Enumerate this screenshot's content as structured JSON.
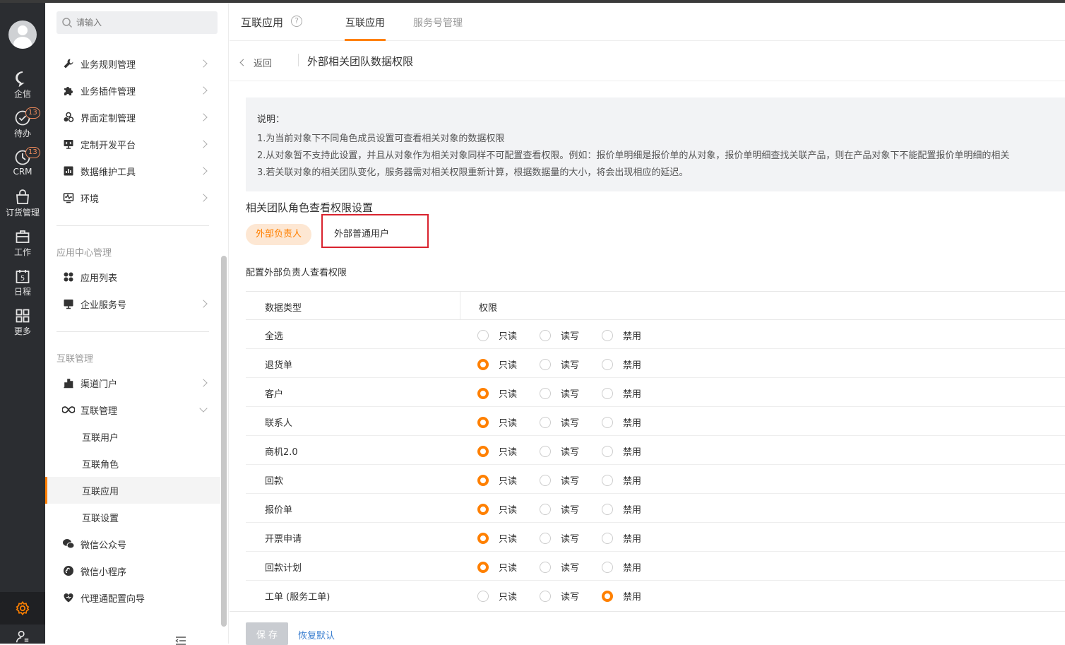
{
  "rail": {
    "items": [
      {
        "label": "企信",
        "icon": "chat-icon"
      },
      {
        "label": "待办",
        "icon": "check-circle-icon",
        "badge": "13"
      },
      {
        "label": "CRM",
        "icon": "clock-icon",
        "badge": "13"
      },
      {
        "label": "订货管理",
        "icon": "bag-icon"
      },
      {
        "label": "工作",
        "icon": "briefcase-icon"
      },
      {
        "label": "日程",
        "icon": "calendar-icon",
        "day": "5"
      },
      {
        "label": "更多",
        "icon": "grid-icon"
      }
    ],
    "accent": "#ff8000"
  },
  "sidebar": {
    "search_placeholder": "请输入",
    "group1": [
      {
        "label": "业务规则管理",
        "icon": "wrench-icon"
      },
      {
        "label": "业务插件管理",
        "icon": "puzzle-icon"
      },
      {
        "label": "界面定制管理",
        "icon": "palette-icon"
      },
      {
        "label": "定制开发平台",
        "icon": "monitor-code-icon"
      },
      {
        "label": "数据维护工具",
        "icon": "bar-chart-icon"
      },
      {
        "label": "环境",
        "icon": "pulse-icon"
      }
    ],
    "section2_title": "应用中心管理",
    "group2": [
      {
        "label": "应用列表",
        "icon": "apps-icon"
      },
      {
        "label": "企业服务号",
        "icon": "desktop-icon"
      }
    ],
    "section3_title": "互联管理",
    "group3": [
      {
        "label": "渠道门户",
        "icon": "building-chart-icon"
      },
      {
        "label": "互联管理",
        "icon": "infinity-icon"
      }
    ],
    "subitems": [
      "互联用户",
      "互联角色",
      "互联应用",
      "互联设置"
    ],
    "group4": [
      {
        "label": "微信公众号",
        "icon": "wechat-icon"
      },
      {
        "label": "微信小程序",
        "icon": "mini-program-icon"
      },
      {
        "label": "代理通配置向导",
        "icon": "heart-icon"
      }
    ]
  },
  "header": {
    "app_title": "互联应用",
    "tabs": [
      "互联应用",
      "服务号管理"
    ]
  },
  "breadcrumb": {
    "back": "返回",
    "title": "外部相关团队数据权限"
  },
  "notice": {
    "title": "说明：",
    "lines": [
      "1.为当前对象下不同角色成员设置可查看相关对象的数据权限",
      "2.从对象暂不支持此设置，并且从对象作为相关对象同样不可配置查看权限。例如：报价单明细是报价单的从对象，报价单明细查找关联产品，则在产品对象下不能配置报价单明细的相关",
      "3.若关联对象的相关团队变化，服务器需对相关权限重新计算，根据数据量的大小，将会出现相应的延迟。"
    ]
  },
  "settings": {
    "title": "相关团队角色查看权限设置",
    "roles": [
      "外部负责人",
      "外部普通用户"
    ],
    "config_title": "配置外部负责人查看权限"
  },
  "table": {
    "headers": [
      "数据类型",
      "权限"
    ],
    "options": [
      "只读",
      "读写",
      "禁用"
    ],
    "rows": [
      {
        "name": "全选",
        "selected": -1
      },
      {
        "name": "退货单",
        "selected": 0
      },
      {
        "name": "客户",
        "selected": 0
      },
      {
        "name": "联系人",
        "selected": 0
      },
      {
        "name": "商机2.0",
        "selected": 0
      },
      {
        "name": "回款",
        "selected": 0
      },
      {
        "name": "报价单",
        "selected": 0
      },
      {
        "name": "开票申请",
        "selected": 0
      },
      {
        "name": "回款计划",
        "selected": 0
      },
      {
        "name": "工单 (服务工单)",
        "selected": 2
      }
    ]
  },
  "footer": {
    "save": "保 存",
    "reset": "恢复默认"
  }
}
